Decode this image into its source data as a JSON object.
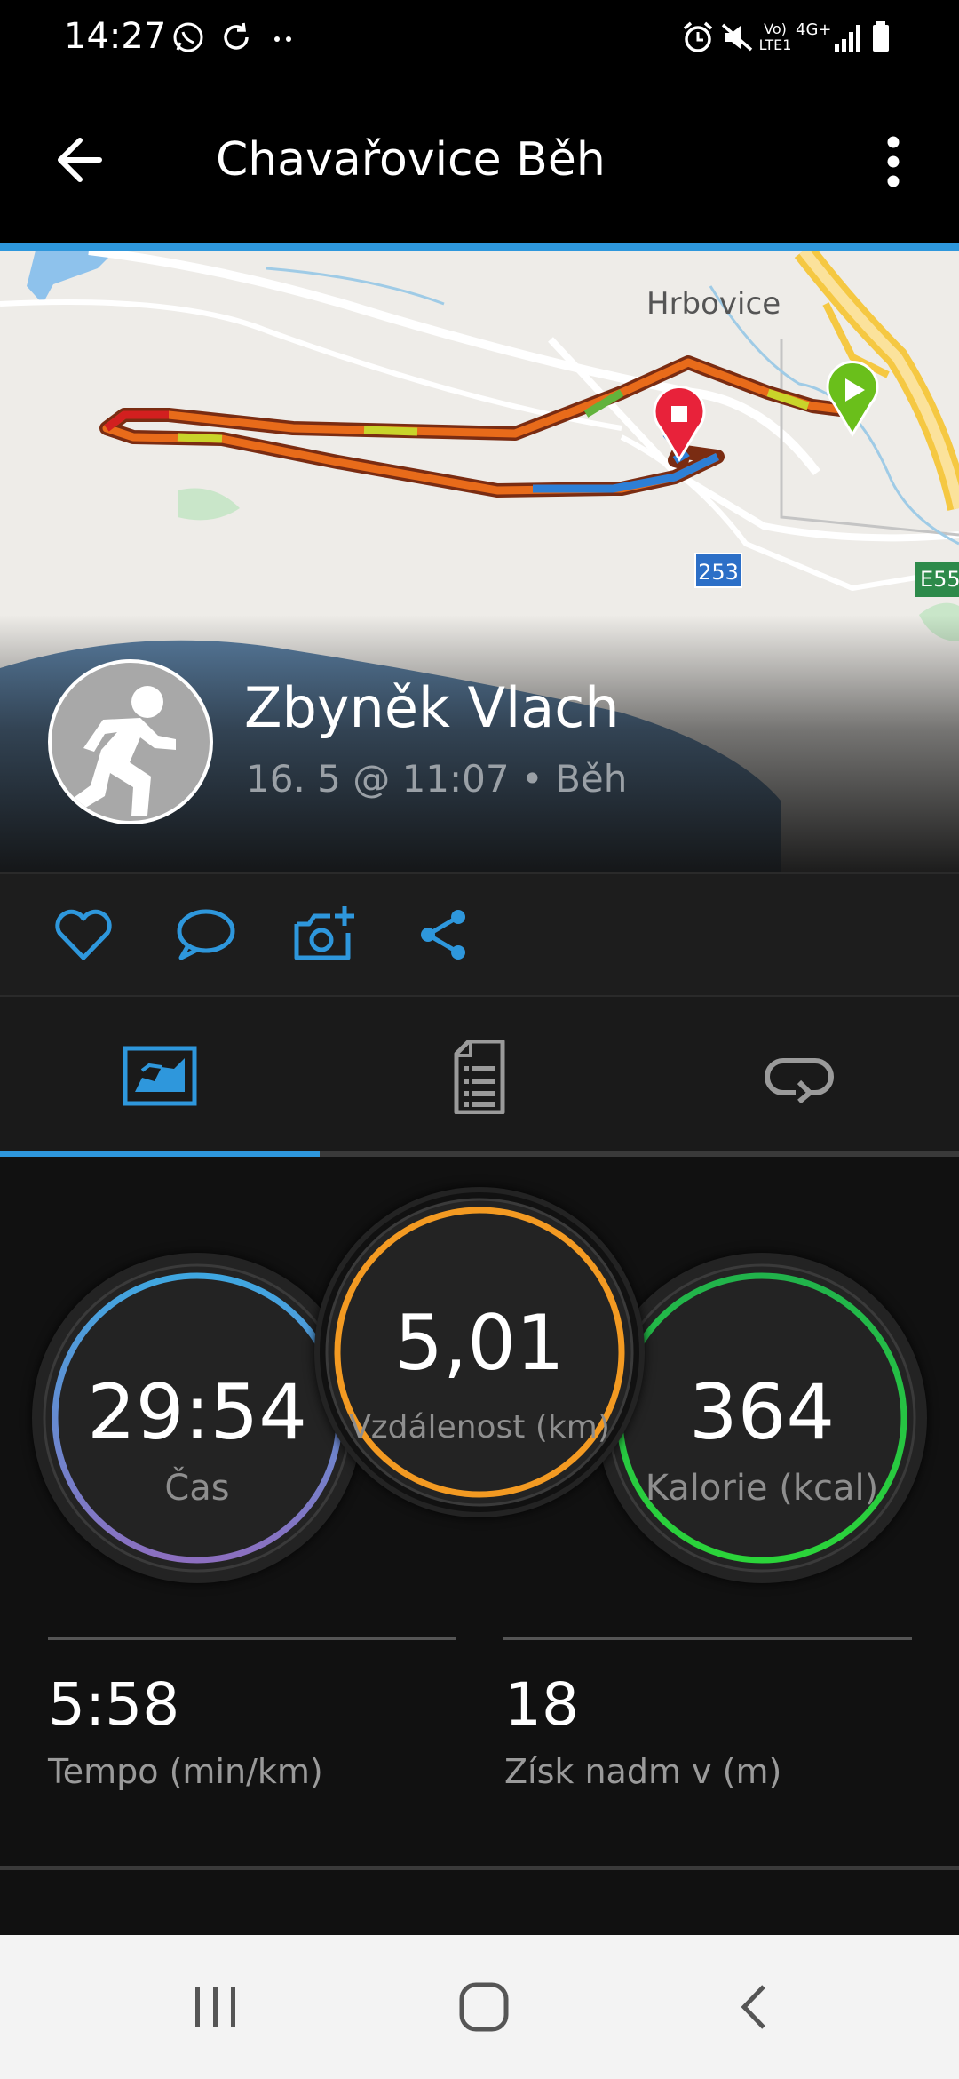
{
  "status_bar": {
    "time": "14:27",
    "left_icons": [
      "whatsapp-icon",
      "sync-icon",
      "more-dots-icon"
    ],
    "right_icons": [
      "alarm-icon",
      "mute-icon",
      "volte-icon",
      "4g-icon",
      "signal-icon",
      "battery-icon"
    ],
    "volte_label": "Vo) LTE1",
    "network_label": "4G+"
  },
  "app_bar": {
    "title": "Chavařovice Běh",
    "back_icon": "arrow-back-icon",
    "more_icon": "more-vert-icon"
  },
  "map": {
    "labels": {
      "town": "Hrbovice",
      "road_badge": "253",
      "road_badge_2": "E55"
    },
    "start_marker_color": "#6abf1b",
    "end_marker_color": "#e8223a"
  },
  "activity": {
    "user_name": "Zbyněk Vlach",
    "meta": "16. 5 @ 11:07 • Běh"
  },
  "actions": [
    {
      "icon": "heart-icon"
    },
    {
      "icon": "comment-icon"
    },
    {
      "icon": "camera-add-icon"
    },
    {
      "icon": "share-icon"
    }
  ],
  "tabs": [
    {
      "icon": "stats-map-icon",
      "selected": true
    },
    {
      "icon": "details-list-icon",
      "selected": false
    },
    {
      "icon": "laps-loop-icon",
      "selected": false
    }
  ],
  "stats": {
    "time": {
      "value": "29:54",
      "label": "Čas"
    },
    "distance": {
      "value": "5,01",
      "label": "Vzdálenost (km)"
    },
    "calories": {
      "value": "364",
      "label": "Kalorie (kcal)"
    },
    "pace": {
      "value": "5:58",
      "label": "Tempo (min/km)"
    },
    "elevation": {
      "value": "18",
      "label": "Získ nadm v (m)"
    }
  },
  "colors": {
    "accent": "#2e97dc",
    "time_ring": [
      "#3fa7e1",
      "#8c6fc0"
    ],
    "distance_ring": "#f39a22",
    "calories_ring": [
      "#21b34b",
      "#2bd43a"
    ]
  },
  "nav_bar": {
    "icons": [
      "recent-apps-icon",
      "home-icon",
      "back-icon"
    ]
  }
}
